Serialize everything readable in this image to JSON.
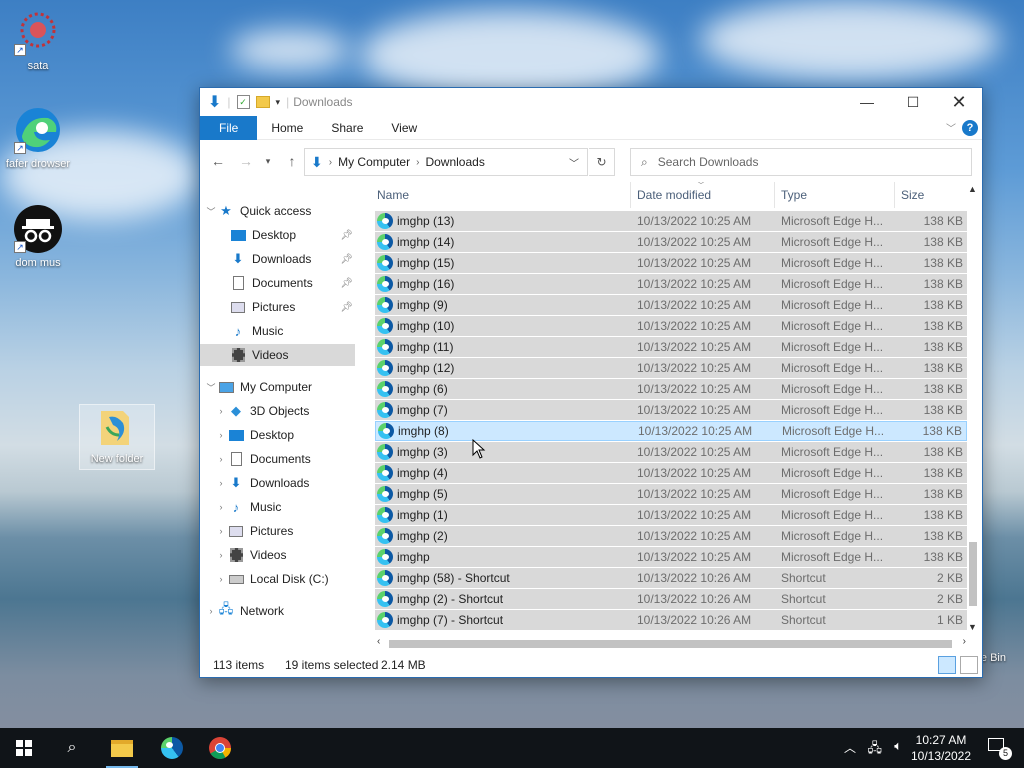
{
  "desktop": {
    "icons": [
      {
        "label": "sata"
      },
      {
        "label": "fafer drowser"
      },
      {
        "label": "dom mus"
      },
      {
        "label": "New folder"
      },
      {
        "label": "e Bin"
      }
    ]
  },
  "window": {
    "title": "Downloads",
    "ribbon": {
      "tabs": [
        "File",
        "Home",
        "Share",
        "View"
      ],
      "help": "?"
    },
    "address": {
      "crumbs": [
        "My Computer",
        "Downloads"
      ]
    },
    "search": {
      "placeholder": "Search Downloads"
    },
    "nav": {
      "quick_access": "Quick access",
      "quick_items": [
        "Desktop",
        "Downloads",
        "Documents",
        "Pictures",
        "Music",
        "Videos"
      ],
      "my_computer": "My Computer",
      "computer_items": [
        "3D Objects",
        "Desktop",
        "Documents",
        "Downloads",
        "Music",
        "Pictures",
        "Videos",
        "Local Disk (C:)"
      ],
      "network": "Network"
    },
    "columns": {
      "name": "Name",
      "date": "Date modified",
      "type": "Type",
      "size": "Size"
    },
    "rows": [
      {
        "name": "imghp (13)",
        "date": "10/13/2022 10:25 AM",
        "type": "Microsoft Edge H...",
        "size": "138 KB",
        "kind": "edge"
      },
      {
        "name": "imghp (14)",
        "date": "10/13/2022 10:25 AM",
        "type": "Microsoft Edge H...",
        "size": "138 KB",
        "kind": "edge"
      },
      {
        "name": "imghp (15)",
        "date": "10/13/2022 10:25 AM",
        "type": "Microsoft Edge H...",
        "size": "138 KB",
        "kind": "edge"
      },
      {
        "name": "imghp (16)",
        "date": "10/13/2022 10:25 AM",
        "type": "Microsoft Edge H...",
        "size": "138 KB",
        "kind": "edge"
      },
      {
        "name": "imghp (9)",
        "date": "10/13/2022 10:25 AM",
        "type": "Microsoft Edge H...",
        "size": "138 KB",
        "kind": "edge"
      },
      {
        "name": "imghp (10)",
        "date": "10/13/2022 10:25 AM",
        "type": "Microsoft Edge H...",
        "size": "138 KB",
        "kind": "edge"
      },
      {
        "name": "imghp (11)",
        "date": "10/13/2022 10:25 AM",
        "type": "Microsoft Edge H...",
        "size": "138 KB",
        "kind": "edge"
      },
      {
        "name": "imghp (12)",
        "date": "10/13/2022 10:25 AM",
        "type": "Microsoft Edge H...",
        "size": "138 KB",
        "kind": "edge"
      },
      {
        "name": "imghp (6)",
        "date": "10/13/2022 10:25 AM",
        "type": "Microsoft Edge H...",
        "size": "138 KB",
        "kind": "edge"
      },
      {
        "name": "imghp (7)",
        "date": "10/13/2022 10:25 AM",
        "type": "Microsoft Edge H...",
        "size": "138 KB",
        "kind": "edge"
      },
      {
        "name": "imghp (8)",
        "date": "10/13/2022 10:25 AM",
        "type": "Microsoft Edge H...",
        "size": "138 KB",
        "kind": "edge"
      },
      {
        "name": "imghp (3)",
        "date": "10/13/2022 10:25 AM",
        "type": "Microsoft Edge H...",
        "size": "138 KB",
        "kind": "edge"
      },
      {
        "name": "imghp (4)",
        "date": "10/13/2022 10:25 AM",
        "type": "Microsoft Edge H...",
        "size": "138 KB",
        "kind": "edge"
      },
      {
        "name": "imghp (5)",
        "date": "10/13/2022 10:25 AM",
        "type": "Microsoft Edge H...",
        "size": "138 KB",
        "kind": "edge"
      },
      {
        "name": "imghp (1)",
        "date": "10/13/2022 10:25 AM",
        "type": "Microsoft Edge H...",
        "size": "138 KB",
        "kind": "edge"
      },
      {
        "name": "imghp (2)",
        "date": "10/13/2022 10:25 AM",
        "type": "Microsoft Edge H...",
        "size": "138 KB",
        "kind": "edge"
      },
      {
        "name": "imghp",
        "date": "10/13/2022 10:25 AM",
        "type": "Microsoft Edge H...",
        "size": "138 KB",
        "kind": "edge"
      },
      {
        "name": "imghp (58) - Shortcut",
        "date": "10/13/2022 10:26 AM",
        "type": "Shortcut",
        "size": "2 KB",
        "kind": "shortcut"
      },
      {
        "name": "imghp (2) - Shortcut",
        "date": "10/13/2022 10:26 AM",
        "type": "Shortcut",
        "size": "2 KB",
        "kind": "shortcut"
      },
      {
        "name": "imghp (7) - Shortcut",
        "date": "10/13/2022 10:26 AM",
        "type": "Shortcut",
        "size": "1 KB",
        "kind": "shortcut"
      }
    ],
    "highlighted_row": 10,
    "status": {
      "items": "113 items",
      "selected": "19 items selected",
      "size": "2.14 MB"
    }
  },
  "taskbar": {
    "time": "10:27 AM",
    "date": "10/13/2022",
    "notifications": "5"
  },
  "colors": {
    "accent": "#1979ca",
    "selection": "#d9d9d9",
    "hover": "#cce8ff",
    "taskbar": "#101418"
  }
}
